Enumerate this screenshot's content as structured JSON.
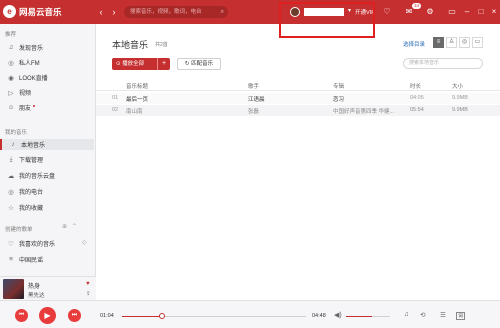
{
  "app": {
    "logo_glyph": "e",
    "name": "网易云音乐"
  },
  "header": {
    "back": "‹",
    "forward": "›",
    "search_placeholder": "搜索音乐，视频，歌词，电台",
    "vip": "开通VIP",
    "badge": "34"
  },
  "sidebar": {
    "section_recommend": "推荐",
    "recommend_items": [
      {
        "label": "发现音乐",
        "icon": "music-note-icon"
      },
      {
        "label": "私人FM",
        "icon": "radio-icon"
      },
      {
        "label": "LOOK直播",
        "icon": "live-icon"
      },
      {
        "label": "视频",
        "icon": "video-icon"
      },
      {
        "label": "朋友",
        "icon": "friends-icon"
      }
    ],
    "section_my_music": "我的音乐",
    "my_music_items": [
      {
        "label": "本地音乐",
        "icon": "local-music-icon"
      },
      {
        "label": "下载管理",
        "icon": "download-icon"
      },
      {
        "label": "我的音乐云盘",
        "icon": "cloud-icon"
      },
      {
        "label": "我的电台",
        "icon": "my-radio-icon"
      },
      {
        "label": "我的收藏",
        "icon": "star-icon"
      }
    ],
    "section_playlists": "创建的歌单",
    "playlist_items": [
      {
        "label": "我喜欢的音乐",
        "icon": "heart-icon"
      },
      {
        "label": "中国民谣",
        "icon": "playlist-icon"
      }
    ]
  },
  "now_playing": {
    "song": "热身",
    "artist": "黑先达"
  },
  "main": {
    "title": "本地音乐",
    "count": "共2首",
    "select_dir": "选择目录",
    "play_all": "播放全部",
    "play_all_add": "+",
    "match": "匹配音乐",
    "search_placeholder": "搜索本地音乐",
    "columns": [
      "音乐标题",
      "歌手",
      "专辑",
      "时长",
      "大小"
    ],
    "rows": [
      {
        "num": "01",
        "title": "最后一页",
        "artist": "江语晨",
        "album": "恋习",
        "duration": "04:05",
        "size": "9.9MB"
      },
      {
        "num": "02",
        "title": "南山南",
        "artist": "张磊",
        "album": "中国好声音第四季 华健...",
        "duration": "05:54",
        "size": "9.9MB"
      }
    ]
  },
  "player": {
    "current_time": "01:04",
    "total_time": "04:48",
    "progress": 0.22,
    "volume": 0.6,
    "lyric": "词"
  },
  "colors": {
    "accent": "#c62f2f"
  }
}
